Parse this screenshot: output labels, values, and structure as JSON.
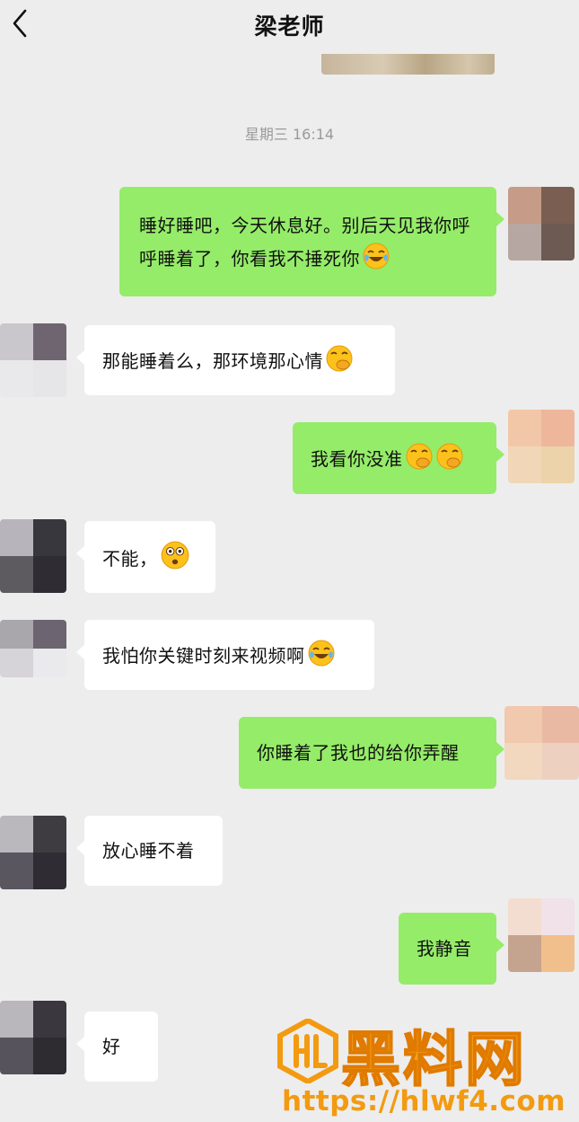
{
  "header": {
    "title": "梁老师",
    "back_icon": "chevron-left-icon"
  },
  "timestamp": "星期三 16:14",
  "messages": [
    {
      "side": "out",
      "text": "睡好睡吧，今天休息好。别后天见我你呼呼睡着了，你看我不捶死你",
      "emoji": "laugh-cry-emoji"
    },
    {
      "side": "in",
      "text": "那能睡着么，那环境那心情",
      "emoji": "giggle-emoji"
    },
    {
      "side": "out",
      "text": "我看你没准",
      "emoji": "giggle-emoji x2"
    },
    {
      "side": "in",
      "text": "不能，",
      "emoji": "astonished-emoji"
    },
    {
      "side": "in",
      "text": "我怕你关键时刻来视频啊",
      "emoji": "laugh-cry-emoji"
    },
    {
      "side": "out",
      "text": "你睡着了我也的给你弄醒"
    },
    {
      "side": "in",
      "text": "放心睡不着"
    },
    {
      "side": "out",
      "text": "我静音"
    },
    {
      "side": "in",
      "text": "好"
    }
  ],
  "watermark": {
    "title": "黑料网",
    "url": "https://hlwf4.com",
    "logo_icon": "hl-logo-icon"
  },
  "colors": {
    "background": "#ededed",
    "outgoing_bubble": "#95ec69",
    "incoming_bubble": "#ffffff",
    "watermark": "#f7a21b"
  }
}
